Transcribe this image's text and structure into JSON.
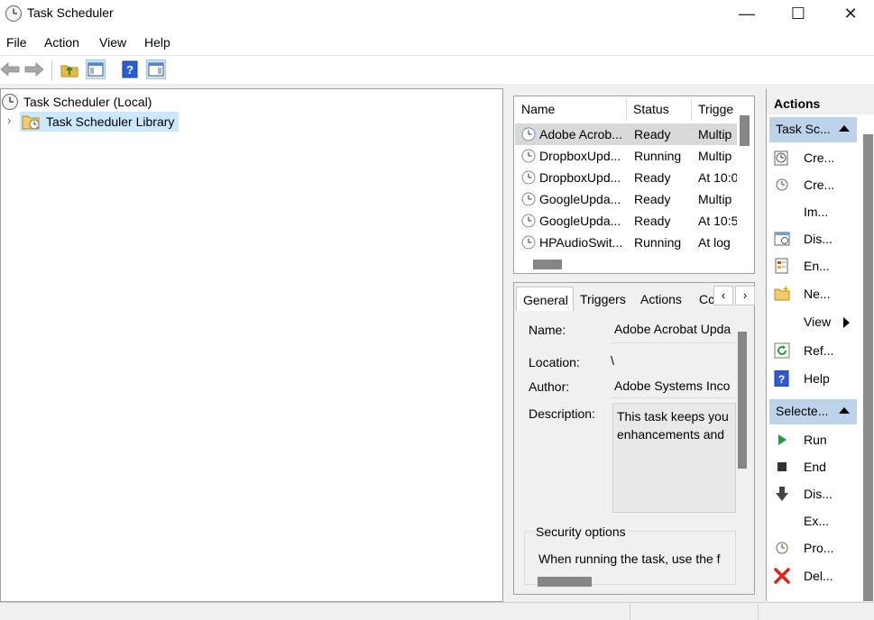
{
  "window": {
    "title": "Task Scheduler",
    "minimize_glyph": "—",
    "maximize_glyph": "☐",
    "close_glyph": "✕"
  },
  "menu": [
    "File",
    "Action",
    "View",
    "Help"
  ],
  "toolbar": {
    "icons": [
      "back-arrow-icon",
      "forward-arrow-icon",
      "up-folder-icon",
      "show-hide-console-tree-icon",
      "help-icon",
      "show-hide-action-pane-icon"
    ]
  },
  "tree": {
    "root": "Task Scheduler (Local)",
    "child": "Task Scheduler Library",
    "expander": "›"
  },
  "task_list": {
    "columns": [
      "Name",
      "Status",
      "Trigge"
    ],
    "rows": [
      {
        "name": "Adobe Acrob...",
        "status": "Ready",
        "trigger": "Multip"
      },
      {
        "name": "DropboxUpd...",
        "status": "Running",
        "trigger": "Multip"
      },
      {
        "name": "DropboxUpd...",
        "status": "Ready",
        "trigger": "At 10:0"
      },
      {
        "name": "GoogleUpda...",
        "status": "Ready",
        "trigger": "Multip"
      },
      {
        "name": "GoogleUpda...",
        "status": "Ready",
        "trigger": "At 10:5"
      },
      {
        "name": "HPAudioSwit...",
        "status": "Running",
        "trigger": "At log"
      }
    ]
  },
  "details": {
    "tabs": [
      "General",
      "Triggers",
      "Actions",
      "Cc"
    ],
    "tab_scroll_left": "‹",
    "tab_scroll_right": "›",
    "name_label": "Name:",
    "name_value": "Adobe Acrobat Upda",
    "location_label": "Location:",
    "location_value": "\\",
    "author_label": "Author:",
    "author_value": "Adobe Systems Inco",
    "description_label": "Description:",
    "description_line1": "This task keeps you",
    "description_line2": "enhancements and",
    "security_heading": "Security options",
    "security_text": "When running the task, use the f"
  },
  "actions_pane": {
    "header": "Actions",
    "group1": "Task Sc...",
    "group1_items": [
      {
        "label": "Cre...",
        "icon": "create-basic-task-icon"
      },
      {
        "label": "Cre...",
        "icon": "create-task-icon"
      },
      {
        "label": "Im...",
        "icon": "import-task-icon"
      },
      {
        "label": "Dis...",
        "icon": "display-running-tasks-icon"
      },
      {
        "label": "En...",
        "icon": "enable-history-icon"
      },
      {
        "label": "Ne...",
        "icon": "new-folder-icon"
      },
      {
        "label": "View",
        "icon": "view-submenu-icon"
      },
      {
        "label": "Ref...",
        "icon": "refresh-icon"
      },
      {
        "label": "Help",
        "icon": "help-icon"
      }
    ],
    "group2": "Selecte...",
    "group2_items": [
      {
        "label": "Run",
        "icon": "run-icon"
      },
      {
        "label": "End",
        "icon": "end-icon"
      },
      {
        "label": "Dis...",
        "icon": "disable-icon"
      },
      {
        "label": "Ex...",
        "icon": "export-icon"
      },
      {
        "label": "Pro...",
        "icon": "properties-icon"
      },
      {
        "label": "Del...",
        "icon": "delete-icon"
      }
    ]
  },
  "colors": {
    "selection": "#cce8ff",
    "action_group_header": "#bcd3ea",
    "run_green": "#1e9e3a",
    "delete_red": "#e0241b",
    "help_blue": "#2a5bd7"
  }
}
